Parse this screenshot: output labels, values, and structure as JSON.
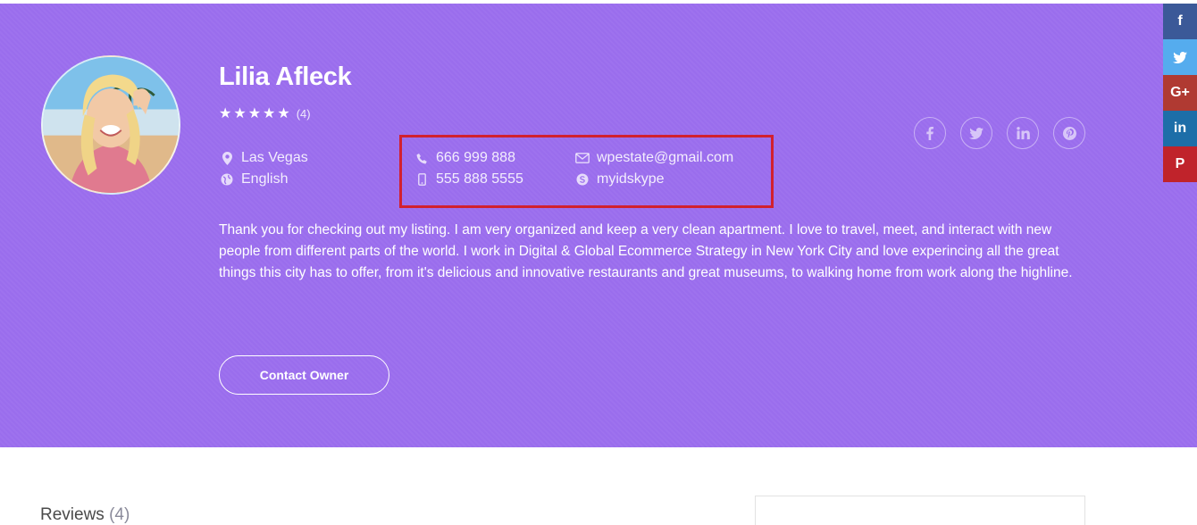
{
  "profile": {
    "name": "Lilia Afleck",
    "rating_stars": 5,
    "rating_count": "(4)",
    "location": "Las Vegas",
    "language": "English",
    "phone": "666 999 888",
    "mobile": "555 888 5555",
    "email": "wpestate@gmail.com",
    "skype": "myidskype",
    "bio": "Thank you for checking out my listing. I am very organized and keep a very clean apartment. I love to travel, meet, and interact with new people from different parts of the world. I work in Digital & Global Ecommerce Strategy in New York City and love experincing all the great things this city has to offer, from it's delicious and innovative restaurants and great museums, to walking home from work along the highline.",
    "contact_button": "Contact Owner"
  },
  "profile_social": [
    "f",
    "t",
    "in",
    "p"
  ],
  "share_bar": [
    {
      "icon": "facebook-icon",
      "label": "f",
      "color": "#3b5998"
    },
    {
      "icon": "twitter-icon",
      "label": "t",
      "color": "#55acee"
    },
    {
      "icon": "google-plus-icon",
      "label": "G+",
      "color": "#b03a32"
    },
    {
      "icon": "linkedin-icon",
      "label": "in",
      "color": "#1d6ea8"
    },
    {
      "icon": "pinterest-icon",
      "label": "P",
      "color": "#c0232b"
    }
  ],
  "reviews": {
    "title": "Reviews",
    "count": "(4)"
  },
  "colors": {
    "hero_bg": "#9a6ded",
    "highlight": "#d2202f"
  }
}
